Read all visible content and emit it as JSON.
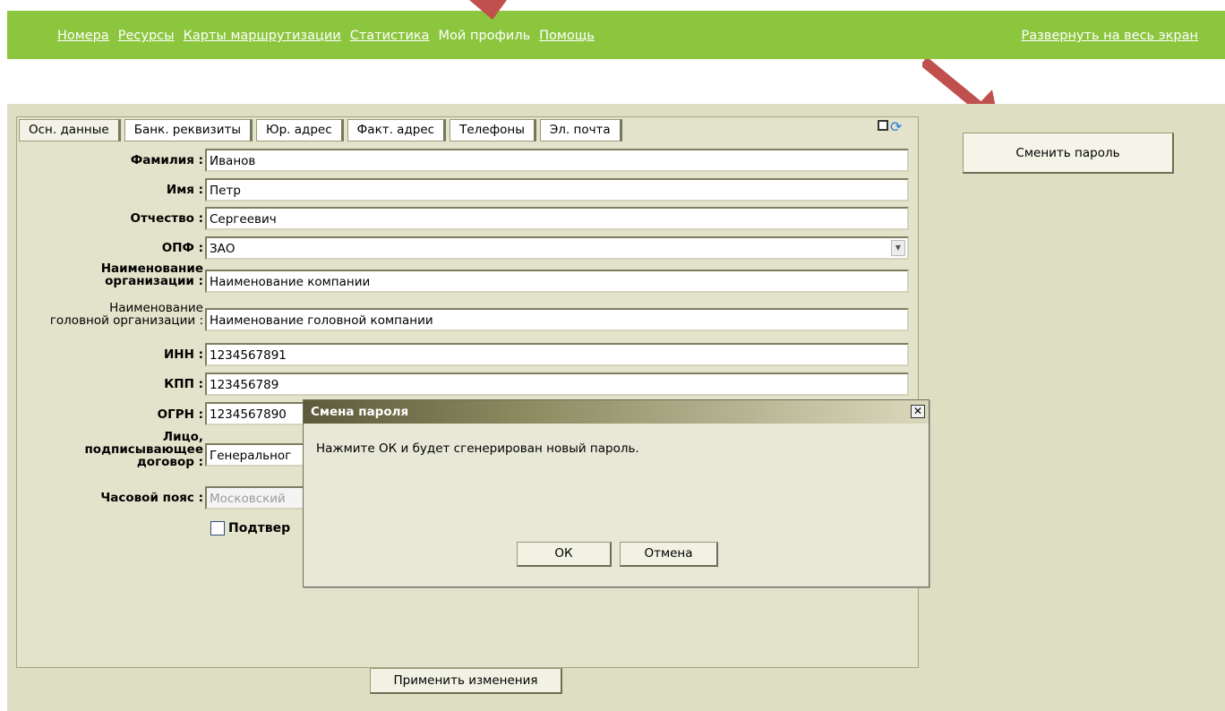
{
  "nav": {
    "items": [
      {
        "label": "Номера"
      },
      {
        "label": "Ресурсы"
      },
      {
        "label": "Карты маршрутизации"
      },
      {
        "label": "Статистика"
      },
      {
        "label": "Мой профиль",
        "active": true
      },
      {
        "label": "Помощь"
      }
    ],
    "fullscreen_label": "Развернуть на весь экран"
  },
  "tabs": [
    {
      "label": "Осн. данные",
      "active": true
    },
    {
      "label": "Банк. реквизиты"
    },
    {
      "label": "Юр. адрес"
    },
    {
      "label": "Факт. адрес"
    },
    {
      "label": "Телефоны"
    },
    {
      "label": "Эл. почта"
    }
  ],
  "form": {
    "lastname": {
      "label": "Фамилия :",
      "value": "Иванов"
    },
    "firstname": {
      "label": "Имя :",
      "value": "Петр"
    },
    "patronymic": {
      "label": "Отчество :",
      "value": "Сергеевич"
    },
    "opf": {
      "label": "ОПФ :",
      "value": "ЗАО"
    },
    "org_name": {
      "label_line1": "Наименование",
      "label_line2": "организации :",
      "value": "Наименование компании"
    },
    "head_org_name": {
      "label_line1": "Наименование",
      "label_line2": "головной организации :",
      "value": "Наименование головной компании"
    },
    "inn": {
      "label": "ИНН :",
      "value": "1234567891"
    },
    "kpp": {
      "label": "КПП :",
      "value": "123456789"
    },
    "ogrn": {
      "label": "ОГРН :",
      "value": "1234567890"
    },
    "signer": {
      "label_line1": "Лицо,",
      "label_line2": "подписывающее",
      "label_line3": "договор :",
      "value": "Генеральног"
    },
    "timezone": {
      "label": "Часовой пояс :",
      "value": "Московский"
    },
    "confirm_label": "Подтвер"
  },
  "apply_button": "Применить изменения",
  "change_password_button": "Сменить пароль",
  "dialog": {
    "title": "Смена пароля",
    "close_glyph": "✕",
    "message": "Нажмите ОК и будет сгенерирован новый пароль.",
    "ok_label": "ОК",
    "cancel_label": "Отмена"
  },
  "colors": {
    "topbar": "#8cc63f",
    "workarea": "#dedec3",
    "arrow": "#c0504d"
  }
}
